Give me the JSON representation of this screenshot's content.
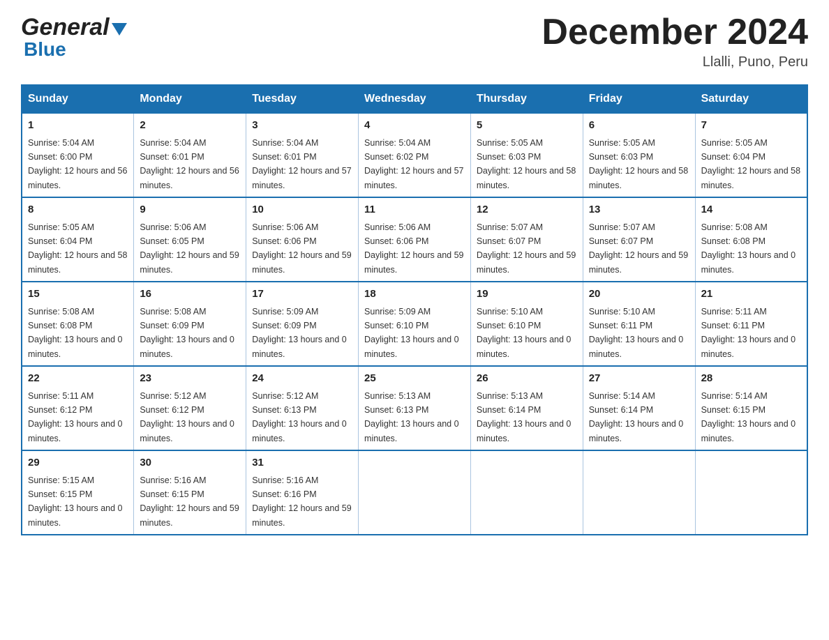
{
  "header": {
    "logo_general": "General",
    "logo_blue": "Blue",
    "title": "December 2024",
    "location": "Llalli, Puno, Peru"
  },
  "days_of_week": [
    "Sunday",
    "Monday",
    "Tuesday",
    "Wednesday",
    "Thursday",
    "Friday",
    "Saturday"
  ],
  "weeks": [
    [
      {
        "day": "1",
        "sunrise": "5:04 AM",
        "sunset": "6:00 PM",
        "daylight": "12 hours and 56 minutes."
      },
      {
        "day": "2",
        "sunrise": "5:04 AM",
        "sunset": "6:01 PM",
        "daylight": "12 hours and 56 minutes."
      },
      {
        "day": "3",
        "sunrise": "5:04 AM",
        "sunset": "6:01 PM",
        "daylight": "12 hours and 57 minutes."
      },
      {
        "day": "4",
        "sunrise": "5:04 AM",
        "sunset": "6:02 PM",
        "daylight": "12 hours and 57 minutes."
      },
      {
        "day": "5",
        "sunrise": "5:05 AM",
        "sunset": "6:03 PM",
        "daylight": "12 hours and 58 minutes."
      },
      {
        "day": "6",
        "sunrise": "5:05 AM",
        "sunset": "6:03 PM",
        "daylight": "12 hours and 58 minutes."
      },
      {
        "day": "7",
        "sunrise": "5:05 AM",
        "sunset": "6:04 PM",
        "daylight": "12 hours and 58 minutes."
      }
    ],
    [
      {
        "day": "8",
        "sunrise": "5:05 AM",
        "sunset": "6:04 PM",
        "daylight": "12 hours and 58 minutes."
      },
      {
        "day": "9",
        "sunrise": "5:06 AM",
        "sunset": "6:05 PM",
        "daylight": "12 hours and 59 minutes."
      },
      {
        "day": "10",
        "sunrise": "5:06 AM",
        "sunset": "6:06 PM",
        "daylight": "12 hours and 59 minutes."
      },
      {
        "day": "11",
        "sunrise": "5:06 AM",
        "sunset": "6:06 PM",
        "daylight": "12 hours and 59 minutes."
      },
      {
        "day": "12",
        "sunrise": "5:07 AM",
        "sunset": "6:07 PM",
        "daylight": "12 hours and 59 minutes."
      },
      {
        "day": "13",
        "sunrise": "5:07 AM",
        "sunset": "6:07 PM",
        "daylight": "12 hours and 59 minutes."
      },
      {
        "day": "14",
        "sunrise": "5:08 AM",
        "sunset": "6:08 PM",
        "daylight": "13 hours and 0 minutes."
      }
    ],
    [
      {
        "day": "15",
        "sunrise": "5:08 AM",
        "sunset": "6:08 PM",
        "daylight": "13 hours and 0 minutes."
      },
      {
        "day": "16",
        "sunrise": "5:08 AM",
        "sunset": "6:09 PM",
        "daylight": "13 hours and 0 minutes."
      },
      {
        "day": "17",
        "sunrise": "5:09 AM",
        "sunset": "6:09 PM",
        "daylight": "13 hours and 0 minutes."
      },
      {
        "day": "18",
        "sunrise": "5:09 AM",
        "sunset": "6:10 PM",
        "daylight": "13 hours and 0 minutes."
      },
      {
        "day": "19",
        "sunrise": "5:10 AM",
        "sunset": "6:10 PM",
        "daylight": "13 hours and 0 minutes."
      },
      {
        "day": "20",
        "sunrise": "5:10 AM",
        "sunset": "6:11 PM",
        "daylight": "13 hours and 0 minutes."
      },
      {
        "day": "21",
        "sunrise": "5:11 AM",
        "sunset": "6:11 PM",
        "daylight": "13 hours and 0 minutes."
      }
    ],
    [
      {
        "day": "22",
        "sunrise": "5:11 AM",
        "sunset": "6:12 PM",
        "daylight": "13 hours and 0 minutes."
      },
      {
        "day": "23",
        "sunrise": "5:12 AM",
        "sunset": "6:12 PM",
        "daylight": "13 hours and 0 minutes."
      },
      {
        "day": "24",
        "sunrise": "5:12 AM",
        "sunset": "6:13 PM",
        "daylight": "13 hours and 0 minutes."
      },
      {
        "day": "25",
        "sunrise": "5:13 AM",
        "sunset": "6:13 PM",
        "daylight": "13 hours and 0 minutes."
      },
      {
        "day": "26",
        "sunrise": "5:13 AM",
        "sunset": "6:14 PM",
        "daylight": "13 hours and 0 minutes."
      },
      {
        "day": "27",
        "sunrise": "5:14 AM",
        "sunset": "6:14 PM",
        "daylight": "13 hours and 0 minutes."
      },
      {
        "day": "28",
        "sunrise": "5:14 AM",
        "sunset": "6:15 PM",
        "daylight": "13 hours and 0 minutes."
      }
    ],
    [
      {
        "day": "29",
        "sunrise": "5:15 AM",
        "sunset": "6:15 PM",
        "daylight": "13 hours and 0 minutes."
      },
      {
        "day": "30",
        "sunrise": "5:16 AM",
        "sunset": "6:15 PM",
        "daylight": "12 hours and 59 minutes."
      },
      {
        "day": "31",
        "sunrise": "5:16 AM",
        "sunset": "6:16 PM",
        "daylight": "12 hours and 59 minutes."
      },
      null,
      null,
      null,
      null
    ]
  ]
}
